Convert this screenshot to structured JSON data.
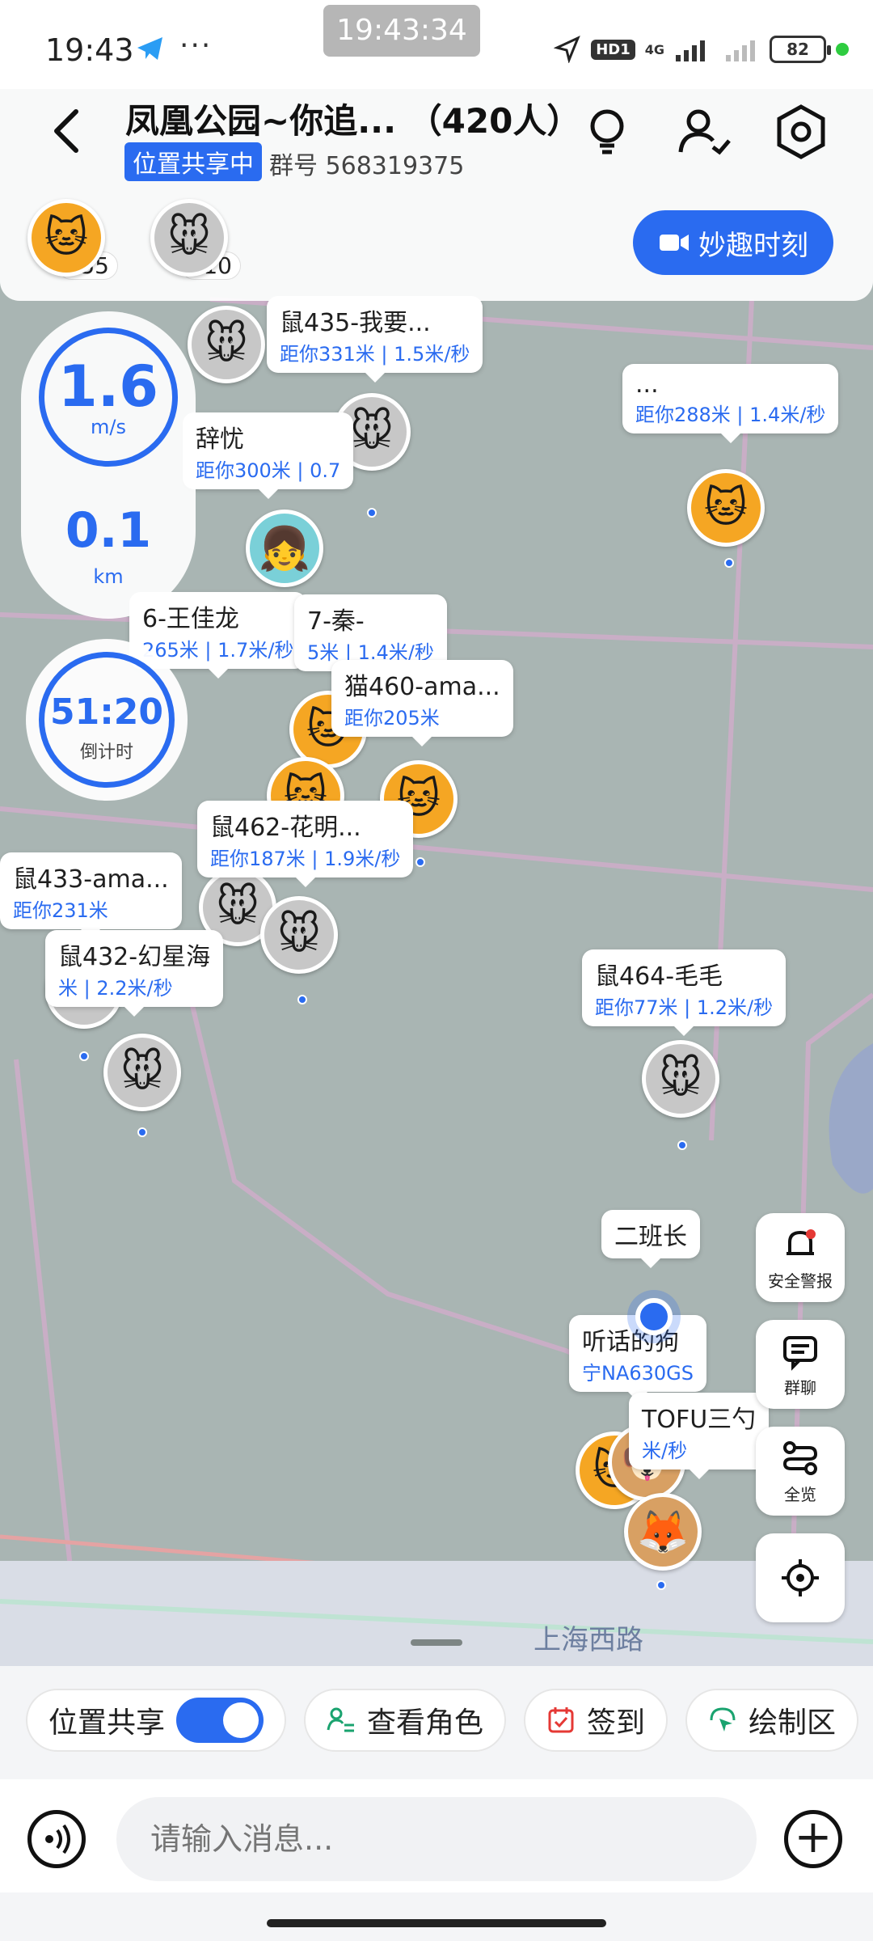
{
  "status_bar": {
    "time": "19:43",
    "more": "···",
    "clock": "19:43:34",
    "hd": "HD1",
    "network": "4G",
    "battery": "82"
  },
  "header": {
    "title": "凤凰公园~你追... （420人）",
    "sharing_badge": "位置共享中",
    "group_id": "群号 568319375",
    "cat_count": "255",
    "mouse_count": "210",
    "fun_moment": "妙趣时刻"
  },
  "stats": {
    "speed": "1.6",
    "speed_unit": "m/s",
    "distance": "0.1",
    "distance_unit": "km",
    "countdown": "51:20",
    "countdown_label": "倒计时"
  },
  "markers": [
    {
      "name": "鼠435-我要...",
      "dist": "距你331米 | 1.5米/秒"
    },
    {
      "name": "...",
      "dist": "距你288米 | 1.4米/秒"
    },
    {
      "name": "辞忧",
      "dist": "距你300米 | 0.7"
    },
    {
      "name": "6-王佳龙",
      "dist": "265米 | 1.7米/秒"
    },
    {
      "name": "7-秦-",
      "dist": "5米 | 1.4米/秒"
    },
    {
      "name": "猫460-ama...",
      "dist": "距你205米"
    },
    {
      "name": "鼠462-花明...",
      "dist": "距你187米 | 1.9米/秒"
    },
    {
      "name": "鼠433-ama...",
      "dist": "距你231米"
    },
    {
      "name": "鼠432-幻星海",
      "dist": "米 | 2.2米/秒"
    },
    {
      "name": "鼠464-毛毛",
      "dist": "距你77米 | 1.2米/秒"
    },
    {
      "name": "二班长",
      "dist": ""
    },
    {
      "name": "听话的狗",
      "dist": "宁NA630GS"
    },
    {
      "name": "TOFU三勺",
      "dist": "米/秒"
    }
  ],
  "road_name": "上海西路",
  "fabs": {
    "alert": "安全警报",
    "chat": "群聊",
    "overview": "全览"
  },
  "chips": {
    "location_share": "位置共享",
    "view_role": "查看角色",
    "checkin": "签到",
    "draw_area": "绘制区"
  },
  "input": {
    "placeholder": "请输入消息..."
  }
}
